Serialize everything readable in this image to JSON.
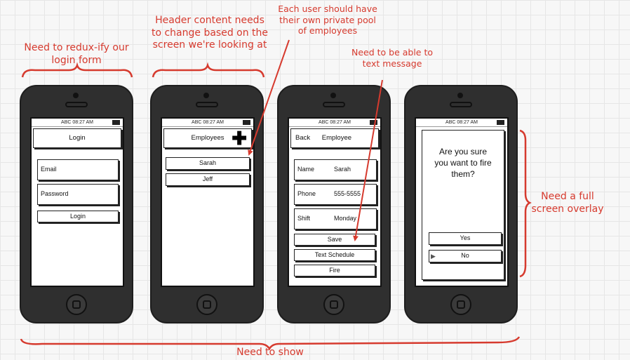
{
  "notes": {
    "redux": "Need to redux-ify our login form",
    "header": "Header content needs to change based on the screen we're looking at",
    "pool": "Each user should have their own private pool of employees",
    "text": "Need to be able to text message",
    "overlay": "Need a full screen overlay",
    "show": "Need to show"
  },
  "status": "ABC 08:27 AM",
  "login": {
    "title": "Login",
    "email": "Email",
    "password": "Password",
    "button": "Login"
  },
  "employees": {
    "title": "Employees",
    "plus": "✚",
    "items": [
      "Sarah",
      "Jeff"
    ]
  },
  "employee": {
    "back": "Back",
    "title": "Employee",
    "fields": [
      {
        "label": "Name",
        "value": "Sarah"
      },
      {
        "label": "Phone",
        "value": "555-5555"
      },
      {
        "label": "Shift",
        "value": "Monday"
      }
    ],
    "save": "Save",
    "text_schedule": "Text Schedule",
    "fire": "Fire"
  },
  "confirm": {
    "question": "Are you sure you want to fire them?",
    "yes": "Yes",
    "no": "No"
  },
  "colors": {
    "annotation": "#d63a2e",
    "phone_body": "#2f2f2f"
  }
}
